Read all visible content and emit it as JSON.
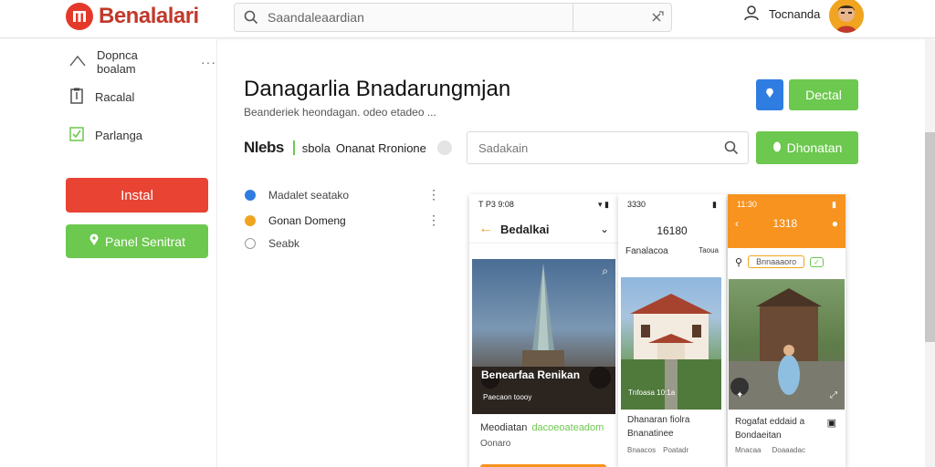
{
  "header": {
    "logo_text": "Benalalari",
    "search_placeholder": "Saandaleaardian",
    "user_label": "Tocnanda"
  },
  "sidebar": {
    "items": [
      {
        "label": "Dopnca boalam",
        "icon": "mountain-icon"
      },
      {
        "label": "Racalal",
        "icon": "bookmark-icon"
      },
      {
        "label": "Parlanga",
        "icon": "checkbox-icon"
      }
    ],
    "install_label": "Instal",
    "panel_label": "Panel Senitrat"
  },
  "main": {
    "title": "Danagarlia Bnadarungmjan",
    "subtitle": "Beanderiek heondagan. odeo etadeo ...",
    "detail_button": "Dectal",
    "tabs": {
      "main": "Nlebs",
      "second": "sbola",
      "third": "Onanat Rronione"
    },
    "search_placeholder": "Sadakain",
    "download_button": "Dhonatan",
    "list": [
      {
        "label": "Madalet seatako",
        "color": "#2f7de1"
      },
      {
        "label": "Gonan Domeng",
        "color": "#f0a420"
      },
      {
        "label": "Seabk",
        "color": "#c8c8c8"
      }
    ]
  },
  "phones": [
    {
      "status_left": "T P3 9:08",
      "header": "Bedalkai",
      "image_caption": "Benearfaa Renikan",
      "caption_small": "Paecaon toooy",
      "footer_title": "Meodiatan",
      "footer_tag": "dacoeoateadom",
      "footer_sub": "Oonaro",
      "accent": "#f0a420"
    },
    {
      "status_left": "3330",
      "header": "16180",
      "sub": "Fanalacoa",
      "sub_right": "Taoua",
      "image_caption": "Tnfoasa 10:1a",
      "footer_title": "Dhanaran fiolra",
      "footer_sub": "Bnanatinee",
      "footer_tag": "Bnaacos",
      "footer_tag_right": "Poatadr"
    },
    {
      "status_left": "11:30",
      "header": "1318",
      "tag": "Bnnaaaoro",
      "footer_title": "Rogafat eddaid a",
      "footer_sub": "Bondaeitan",
      "footer_tag": "Mnacaa",
      "footer_tag_right": "Doaaadac",
      "accent": "#f7931e"
    }
  ]
}
